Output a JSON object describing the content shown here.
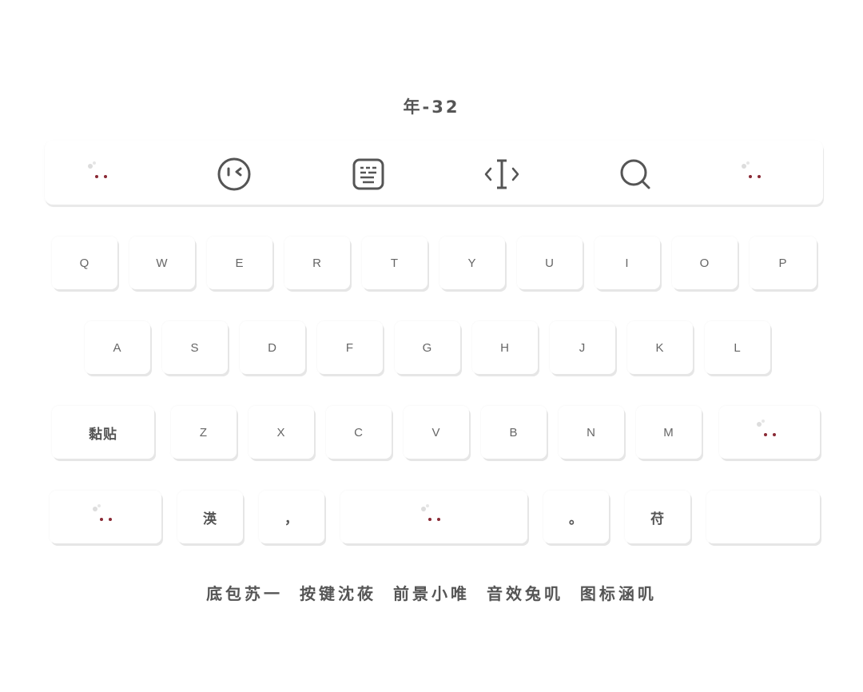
{
  "title": "年-32",
  "toolbar": {
    "items": [
      {
        "icon": "mascot-icon"
      },
      {
        "icon": "emoji-face-icon"
      },
      {
        "icon": "keyboard-icon"
      },
      {
        "icon": "text-cursor-icon"
      },
      {
        "icon": "search-icon"
      },
      {
        "icon": "mascot-icon"
      }
    ]
  },
  "keyboard": {
    "row1": [
      "Q",
      "W",
      "E",
      "R",
      "T",
      "Y",
      "U",
      "I",
      "O",
      "P"
    ],
    "row2": [
      "A",
      "S",
      "D",
      "F",
      "G",
      "H",
      "J",
      "K",
      "L"
    ],
    "row3": {
      "paste": "黏贴",
      "letters": [
        "Z",
        "X",
        "C",
        "V",
        "B",
        "N",
        "M"
      ]
    },
    "row4": {
      "lang": "渶",
      "comma": "，",
      "period": "。",
      "symbol": "苻"
    }
  },
  "footer": "底包苏一 按键沈莜 前景小唯 音效兔叽 图标涵叽",
  "colors": {
    "background": "#ffffff",
    "key": "#ffffff",
    "key_shadow": "#e6e6e6",
    "text": "#555555",
    "mascot_eye": "#8a2a35"
  }
}
